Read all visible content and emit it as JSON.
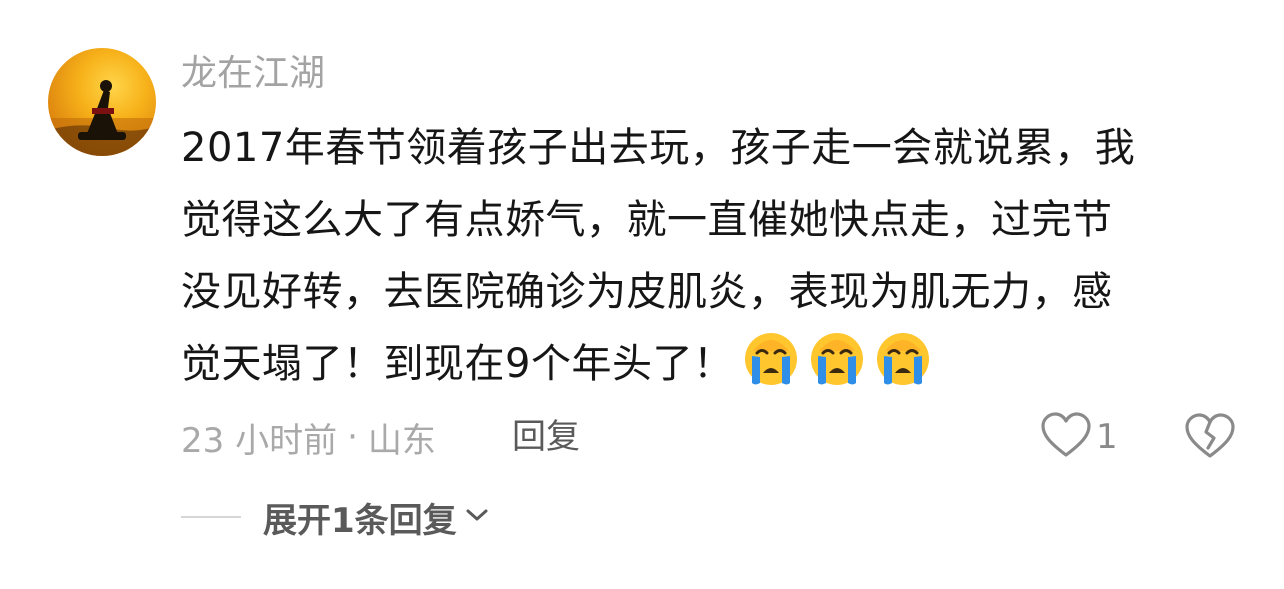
{
  "comment": {
    "username": "龙在江湖",
    "text_lines": [
      "2017年春节领着孩子出去玩，孩子走一会就说累，我",
      "觉得这么大了有点娇气，就一直催她快点走，过完节",
      "没见好转，去医院确诊为皮肌炎，表现为肌无力，感",
      "觉天塌了！到现在9个年头了！"
    ],
    "emojis": [
      "crying-face-icon",
      "crying-face-icon",
      "crying-face-icon"
    ],
    "time": "23 小时前",
    "separator": "·",
    "location": "山东",
    "reply_label": "回复",
    "like_count": "1",
    "expand_label": "展开1条回复"
  },
  "colors": {
    "username": "#a3a3a3",
    "text": "#161616",
    "meta": "#a9a9a9",
    "action": "#5a5a5a"
  }
}
